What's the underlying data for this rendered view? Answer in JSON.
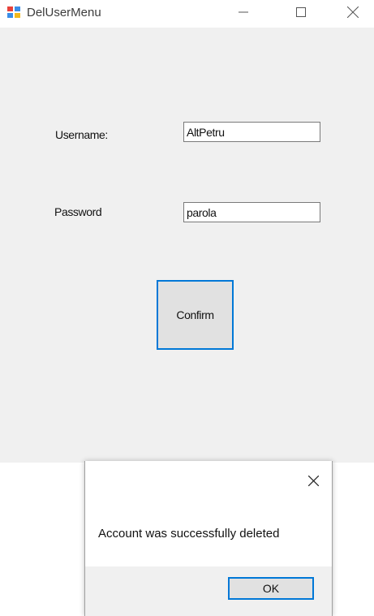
{
  "window": {
    "title": "DelUserMenu",
    "app_icon": "winforms-app-icon",
    "controls": {
      "minimize_icon": "minimize-icon",
      "maximize_icon": "maximize-icon",
      "close_icon": "close-icon"
    }
  },
  "form": {
    "username_label": "Username:",
    "username_value": "AltPetru",
    "password_label": "Password",
    "password_value": "parola",
    "confirm_label": "Confirm"
  },
  "message_box": {
    "message": "Account was successfully deleted",
    "ok_label": "OK",
    "close_icon": "close-icon"
  },
  "colors": {
    "accent": "#0078d7",
    "window_bg": "#f0f0f0",
    "button_bg": "#e1e1e1"
  }
}
